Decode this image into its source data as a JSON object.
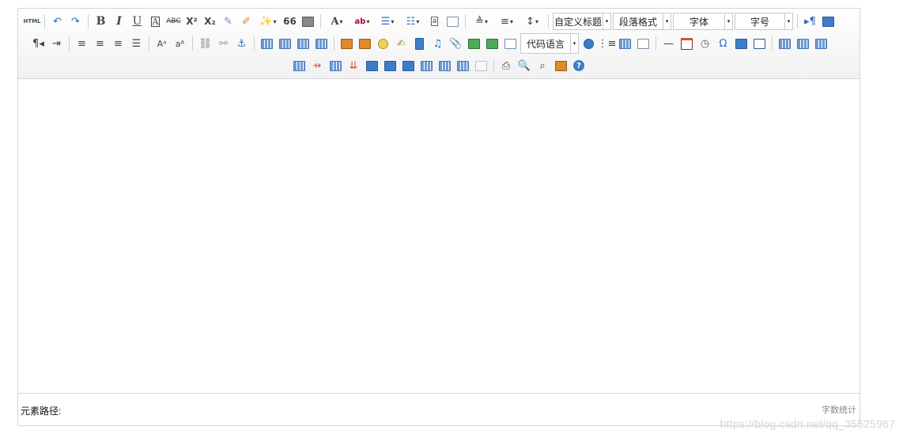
{
  "toolbar": {
    "html_label": "HTML",
    "bold_label": "B",
    "italic_label": "I",
    "underline_label": "U",
    "strike_label": "ABC",
    "superscript_label": "X²",
    "subscript_label": "X₂",
    "quote_label": "66",
    "font_color_label": "A",
    "back_color_label": "ab",
    "omega_label": "Ω",
    "dropdown_glyph": "▾",
    "custom_title": "自定义标题",
    "paragraph_format": "段落格式",
    "font_family": "字体",
    "font_size": "字号",
    "code_language": "代码语言"
  },
  "statusbar": {
    "element_path_label": "元素路径:",
    "word_count_label": "字数统计"
  },
  "watermark": "https://blog.csdn.net/qq_35525967",
  "colors": {
    "icon_blue": "#3d7cc9",
    "toolbar_bg": "#f1f1f1",
    "border": "#d4d4d4"
  }
}
